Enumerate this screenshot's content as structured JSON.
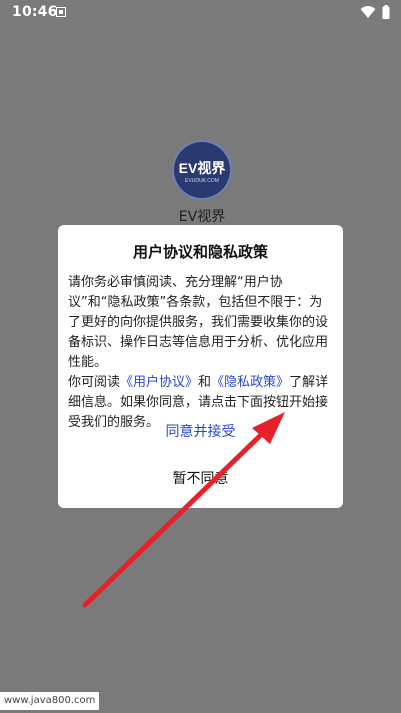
{
  "status_bar": {
    "time": "10:46",
    "icons": [
      "notification-icon",
      "wifi-icon",
      "battery-icon"
    ]
  },
  "app": {
    "logo_text": "EV视界",
    "logo_subtext": "EVUDUK.COM",
    "name": "EV视界"
  },
  "dialog": {
    "title": "用户协议和隐私政策",
    "paragraph1": "请你务必审慎阅读、充分理解“用户协议”和“隐私政策”各条款，包括但不限于：为了更好的向你提供服务，我们需要收集你的设备标识、操作日志等信息用于分析、优化应用性能。",
    "paragraph2_prefix": "你可阅读",
    "user_agreement_link": "《用户协议》",
    "paragraph2_and": "和",
    "privacy_policy_link": "《隐私政策》",
    "paragraph2_suffix": "了解详细信息。如果你同意，请点击下面按钮开始接受我们的服务。",
    "agree_label": "同意并接受",
    "decline_label": "暂不同意"
  },
  "colors": {
    "overlay": "#7a7a7a",
    "link": "#2747d1",
    "arrow": "#e8202a"
  },
  "watermark": "www.java800.com"
}
